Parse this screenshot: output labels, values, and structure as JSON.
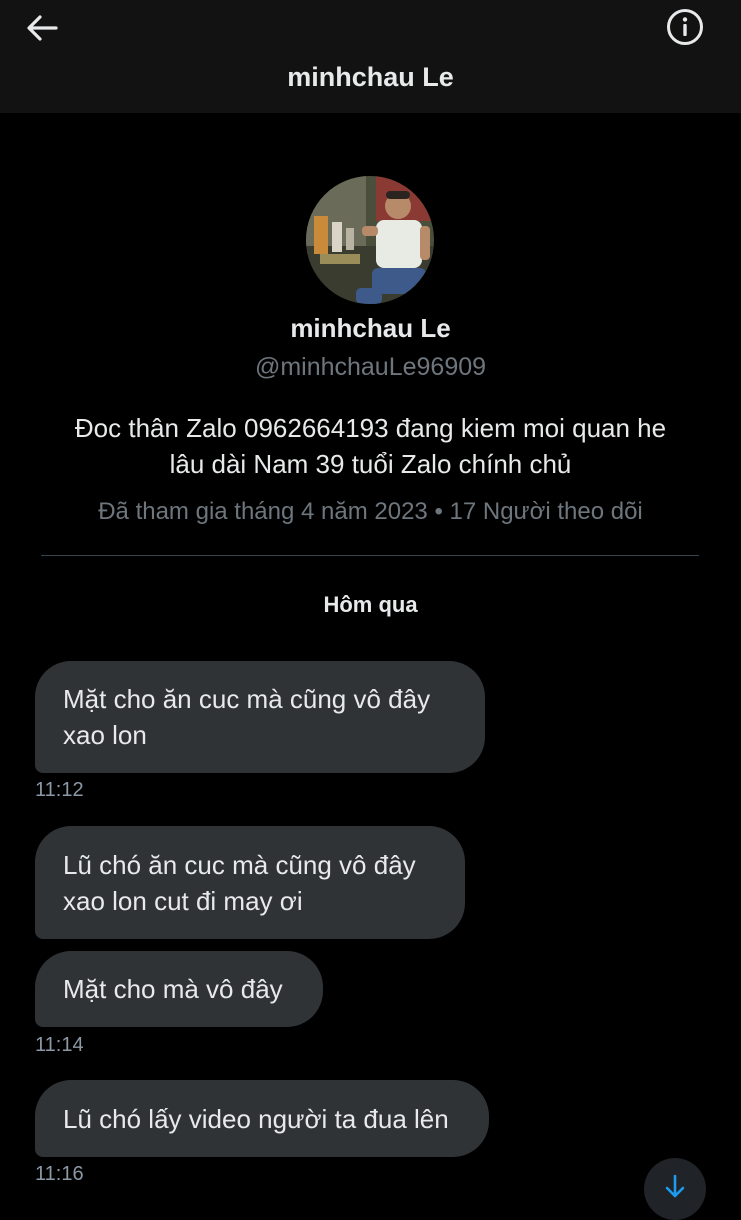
{
  "header": {
    "title": "minhchau Le",
    "back_icon": "arrow-left-icon",
    "info_icon": "info-circle-icon"
  },
  "profile": {
    "name": "minhchau Le",
    "handle": "@minhchauLe96909",
    "bio_line1": "Đoc thân Zalo 0962664193 đang kiem moi quan he",
    "bio_line2": "lâu dài Nam 39 tuổi Zalo chính chủ",
    "meta": "Đã tham gia tháng 4 năm 2023 • 17 Người theo dõi"
  },
  "conversation": {
    "day_label": "Hôm qua",
    "messages": [
      {
        "line1": "Mặt cho ăn cuc mà cũng vô đây",
        "line2": "xao lon",
        "time": "11:12"
      },
      {
        "line1": "Lũ chó ăn cuc mà cũng vô đây",
        "line2": "xao lon cut đi may ơi"
      },
      {
        "line1": "Mặt cho mà vô đây",
        "time": "11:14"
      },
      {
        "line1": "Lũ chó lấy video người ta đua lên",
        "time": "11:16"
      }
    ]
  },
  "colors": {
    "background": "#000000",
    "header_background": "#121212",
    "bubble": "#2f3336",
    "muted_text": "#6e767d",
    "accent": "#1d9bf0"
  },
  "scroll_button": {
    "icon": "arrow-down-icon"
  }
}
